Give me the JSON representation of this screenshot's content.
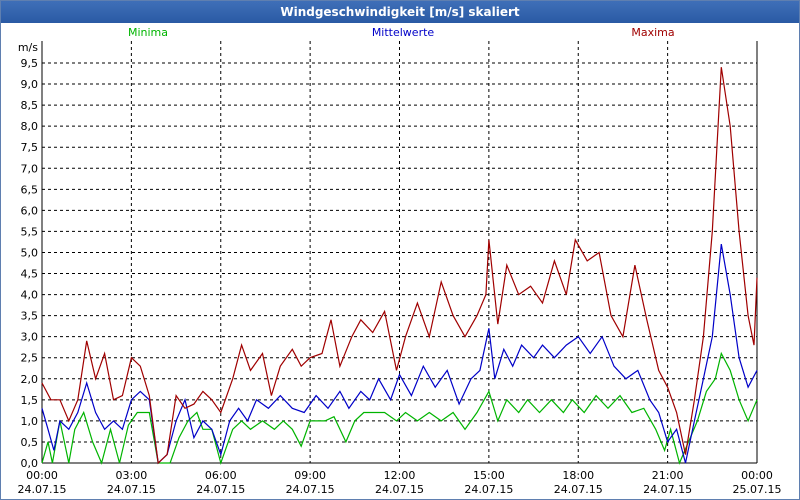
{
  "window": {
    "title": "Windgeschwindigkeit [m/s] skaliert"
  },
  "chart_data": {
    "type": "line",
    "title": "Windgeschwindigkeit [m/s] skaliert",
    "ylabel": "m/s",
    "ylim": [
      0,
      9.5
    ],
    "xlim": [
      0,
      24
    ],
    "grid": true,
    "legend": "top",
    "y_ticks": [
      "0,0",
      "0,5",
      "1,0",
      "1,5",
      "2,0",
      "2,5",
      "3,0",
      "3,5",
      "4,0",
      "4,5",
      "5,0",
      "5,5",
      "6,0",
      "6,5",
      "7,0",
      "7,5",
      "8,0",
      "8,5",
      "9,0",
      "9,5"
    ],
    "x_ticks": [
      {
        "time": "00:00",
        "date": "24.07.15"
      },
      {
        "time": "03:00",
        "date": "24.07.15"
      },
      {
        "time": "06:00",
        "date": "24.07.15"
      },
      {
        "time": "09:00",
        "date": "24.07.15"
      },
      {
        "time": "12:00",
        "date": "24.07.15"
      },
      {
        "time": "15:00",
        "date": "24.07.15"
      },
      {
        "time": "18:00",
        "date": "24.07.15"
      },
      {
        "time": "21:00",
        "date": "24.07.15"
      },
      {
        "time": "00:00",
        "date": "25.07.15"
      }
    ],
    "series": [
      {
        "name": "Minima",
        "color": "#00b400",
        "points": [
          [
            0,
            0
          ],
          [
            0.2,
            0.5
          ],
          [
            0.35,
            0
          ],
          [
            0.6,
            1
          ],
          [
            0.9,
            0
          ],
          [
            1.1,
            0.8
          ],
          [
            1.4,
            1.2
          ],
          [
            1.7,
            0.5
          ],
          [
            2.0,
            0
          ],
          [
            2.3,
            0.8
          ],
          [
            2.6,
            0
          ],
          [
            2.9,
            0.9
          ],
          [
            3.2,
            1.2
          ],
          [
            3.6,
            1.2
          ],
          [
            3.9,
            0
          ],
          [
            4.3,
            0
          ],
          [
            4.6,
            0.6
          ],
          [
            4.9,
            1.0
          ],
          [
            5.2,
            1.2
          ],
          [
            5.4,
            0.8
          ],
          [
            5.7,
            0.8
          ],
          [
            6.0,
            0
          ],
          [
            6.4,
            0.8
          ],
          [
            6.7,
            1.0
          ],
          [
            7.0,
            0.8
          ],
          [
            7.4,
            1.0
          ],
          [
            7.8,
            0.8
          ],
          [
            8.1,
            1.0
          ],
          [
            8.4,
            0.8
          ],
          [
            8.7,
            0.4
          ],
          [
            9.0,
            1.0
          ],
          [
            9.5,
            1.0
          ],
          [
            9.8,
            1.1
          ],
          [
            10.2,
            0.5
          ],
          [
            10.5,
            1.0
          ],
          [
            10.8,
            1.2
          ],
          [
            11.1,
            1.2
          ],
          [
            11.5,
            1.2
          ],
          [
            11.9,
            1.0
          ],
          [
            12.2,
            1.2
          ],
          [
            12.6,
            1.0
          ],
          [
            13.0,
            1.2
          ],
          [
            13.4,
            1.0
          ],
          [
            13.8,
            1.2
          ],
          [
            14.2,
            0.8
          ],
          [
            14.6,
            1.2
          ],
          [
            15.0,
            1.7
          ],
          [
            15.3,
            1.0
          ],
          [
            15.6,
            1.5
          ],
          [
            16.0,
            1.2
          ],
          [
            16.3,
            1.5
          ],
          [
            16.7,
            1.2
          ],
          [
            17.1,
            1.5
          ],
          [
            17.5,
            1.2
          ],
          [
            17.8,
            1.5
          ],
          [
            18.2,
            1.2
          ],
          [
            18.6,
            1.6
          ],
          [
            19.0,
            1.3
          ],
          [
            19.4,
            1.6
          ],
          [
            19.8,
            1.2
          ],
          [
            20.2,
            1.3
          ],
          [
            20.6,
            0.8
          ],
          [
            20.9,
            0.3
          ],
          [
            21.1,
            0.8
          ],
          [
            21.4,
            0
          ],
          [
            21.7,
            0.5
          ],
          [
            22.0,
            1.0
          ],
          [
            22.3,
            1.7
          ],
          [
            22.6,
            2.0
          ],
          [
            22.8,
            2.6
          ],
          [
            23.1,
            2.2
          ],
          [
            23.4,
            1.5
          ],
          [
            23.7,
            1.0
          ],
          [
            24.0,
            1.5
          ]
        ]
      },
      {
        "name": "Mittelwerte",
        "color": "#0000c8",
        "points": [
          [
            0,
            1.3
          ],
          [
            0.2,
            0.8
          ],
          [
            0.4,
            0.3
          ],
          [
            0.6,
            1.0
          ],
          [
            0.9,
            0.8
          ],
          [
            1.2,
            1.2
          ],
          [
            1.5,
            1.9
          ],
          [
            1.8,
            1.2
          ],
          [
            2.1,
            0.8
          ],
          [
            2.4,
            1.0
          ],
          [
            2.7,
            0.8
          ],
          [
            3.0,
            1.5
          ],
          [
            3.3,
            1.7
          ],
          [
            3.6,
            1.5
          ],
          [
            3.9,
            0
          ],
          [
            4.2,
            0.2
          ],
          [
            4.5,
            1.0
          ],
          [
            4.8,
            1.5
          ],
          [
            5.1,
            0.6
          ],
          [
            5.4,
            1.0
          ],
          [
            5.7,
            0.8
          ],
          [
            6.0,
            0.2
          ],
          [
            6.3,
            1.0
          ],
          [
            6.6,
            1.3
          ],
          [
            6.9,
            1.0
          ],
          [
            7.2,
            1.5
          ],
          [
            7.6,
            1.3
          ],
          [
            8.0,
            1.6
          ],
          [
            8.4,
            1.3
          ],
          [
            8.8,
            1.2
          ],
          [
            9.2,
            1.6
          ],
          [
            9.6,
            1.3
          ],
          [
            10.0,
            1.7
          ],
          [
            10.3,
            1.3
          ],
          [
            10.7,
            1.7
          ],
          [
            11.0,
            1.5
          ],
          [
            11.3,
            2.0
          ],
          [
            11.7,
            1.5
          ],
          [
            12.0,
            2.1
          ],
          [
            12.4,
            1.6
          ],
          [
            12.8,
            2.3
          ],
          [
            13.2,
            1.8
          ],
          [
            13.6,
            2.2
          ],
          [
            14.0,
            1.4
          ],
          [
            14.4,
            2.0
          ],
          [
            14.7,
            2.2
          ],
          [
            15.0,
            3.2
          ],
          [
            15.2,
            2.0
          ],
          [
            15.5,
            2.7
          ],
          [
            15.8,
            2.3
          ],
          [
            16.1,
            2.8
          ],
          [
            16.5,
            2.5
          ],
          [
            16.8,
            2.8
          ],
          [
            17.2,
            2.5
          ],
          [
            17.6,
            2.8
          ],
          [
            18.0,
            3.0
          ],
          [
            18.4,
            2.6
          ],
          [
            18.8,
            3.0
          ],
          [
            19.2,
            2.3
          ],
          [
            19.6,
            2.0
          ],
          [
            20.0,
            2.2
          ],
          [
            20.4,
            1.5
          ],
          [
            20.7,
            1.2
          ],
          [
            21.0,
            0.5
          ],
          [
            21.3,
            0.8
          ],
          [
            21.6,
            0
          ],
          [
            21.9,
            1.0
          ],
          [
            22.2,
            2.0
          ],
          [
            22.5,
            3.0
          ],
          [
            22.8,
            5.2
          ],
          [
            23.1,
            4.0
          ],
          [
            23.4,
            2.5
          ],
          [
            23.7,
            1.8
          ],
          [
            24.0,
            2.2
          ]
        ]
      },
      {
        "name": "Maxima",
        "color": "#a00000",
        "points": [
          [
            0,
            1.9
          ],
          [
            0.3,
            1.5
          ],
          [
            0.6,
            1.5
          ],
          [
            0.9,
            1.0
          ],
          [
            1.2,
            1.5
          ],
          [
            1.5,
            2.9
          ],
          [
            1.8,
            2.0
          ],
          [
            2.1,
            2.6
          ],
          [
            2.4,
            1.5
          ],
          [
            2.7,
            1.6
          ],
          [
            3.0,
            2.5
          ],
          [
            3.3,
            2.3
          ],
          [
            3.6,
            1.6
          ],
          [
            3.9,
            0
          ],
          [
            4.2,
            0.2
          ],
          [
            4.5,
            1.6
          ],
          [
            4.8,
            1.3
          ],
          [
            5.1,
            1.4
          ],
          [
            5.4,
            1.7
          ],
          [
            5.7,
            1.5
          ],
          [
            6.0,
            1.2
          ],
          [
            6.4,
            2.0
          ],
          [
            6.7,
            2.8
          ],
          [
            7.0,
            2.2
          ],
          [
            7.4,
            2.6
          ],
          [
            7.7,
            1.6
          ],
          [
            8.0,
            2.3
          ],
          [
            8.4,
            2.7
          ],
          [
            8.7,
            2.3
          ],
          [
            9.0,
            2.5
          ],
          [
            9.4,
            2.6
          ],
          [
            9.7,
            3.4
          ],
          [
            10.0,
            2.3
          ],
          [
            10.4,
            3.0
          ],
          [
            10.7,
            3.4
          ],
          [
            11.1,
            3.1
          ],
          [
            11.5,
            3.6
          ],
          [
            11.9,
            2.2
          ],
          [
            12.2,
            3.0
          ],
          [
            12.6,
            3.8
          ],
          [
            13.0,
            3.0
          ],
          [
            13.4,
            4.3
          ],
          [
            13.8,
            3.5
          ],
          [
            14.2,
            3.0
          ],
          [
            14.6,
            3.5
          ],
          [
            14.9,
            4.0
          ],
          [
            15.0,
            5.3
          ],
          [
            15.3,
            3.3
          ],
          [
            15.6,
            4.7
          ],
          [
            16.0,
            4.0
          ],
          [
            16.4,
            4.2
          ],
          [
            16.8,
            3.8
          ],
          [
            17.2,
            4.8
          ],
          [
            17.6,
            4.0
          ],
          [
            17.9,
            5.3
          ],
          [
            18.3,
            4.8
          ],
          [
            18.7,
            5.0
          ],
          [
            19.1,
            3.5
          ],
          [
            19.5,
            3.0
          ],
          [
            19.9,
            4.7
          ],
          [
            20.3,
            3.4
          ],
          [
            20.7,
            2.2
          ],
          [
            21.0,
            1.8
          ],
          [
            21.3,
            1.2
          ],
          [
            21.6,
            0.2
          ],
          [
            21.9,
            1.5
          ],
          [
            22.2,
            3.0
          ],
          [
            22.5,
            5.5
          ],
          [
            22.8,
            9.4
          ],
          [
            23.1,
            8.0
          ],
          [
            23.4,
            5.5
          ],
          [
            23.7,
            3.5
          ],
          [
            23.9,
            2.8
          ],
          [
            24.0,
            4.4
          ]
        ]
      }
    ]
  }
}
